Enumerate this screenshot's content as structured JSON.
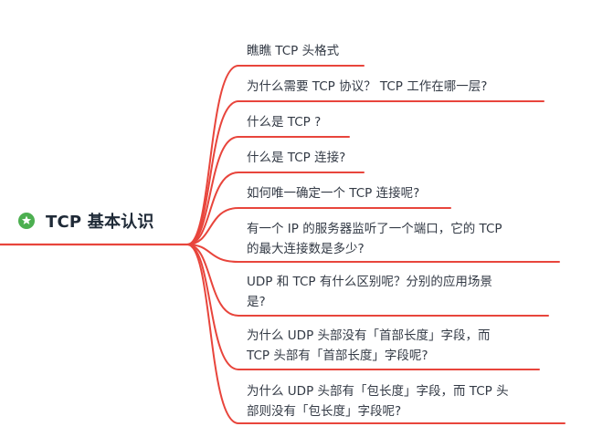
{
  "mindmap": {
    "root": {
      "title": "TCP 基本认识",
      "icon": "star-badge-icon",
      "icon_color": "#4CAF50"
    },
    "branch_color": "#E8453C",
    "topics": [
      {
        "lines": [
          "瞧瞧 TCP 头格式"
        ]
      },
      {
        "lines": [
          "为什么需要 TCP 协议？ TCP 工作在哪一层?"
        ]
      },
      {
        "lines": [
          "什么是 TCP ?"
        ]
      },
      {
        "lines": [
          "什么是 TCP 连接?"
        ]
      },
      {
        "lines": [
          "如何唯一确定一个 TCP 连接呢?"
        ]
      },
      {
        "lines": [
          "有一个 IP 的服务器监听了一个端口，它的 TCP",
          "的最大连接数是多少?"
        ]
      },
      {
        "lines": [
          "UDP 和 TCP 有什么区别呢？分别的应用场景",
          "是?"
        ]
      },
      {
        "lines": [
          "为什么 UDP 头部没有「首部长度」字段，而",
          "TCP 头部有「首部长度」字段呢?"
        ]
      },
      {
        "lines": [
          "为什么 UDP 头部有「包长度」字段，而 TCP 头",
          "部则没有「包长度」字段呢?"
        ]
      }
    ]
  }
}
